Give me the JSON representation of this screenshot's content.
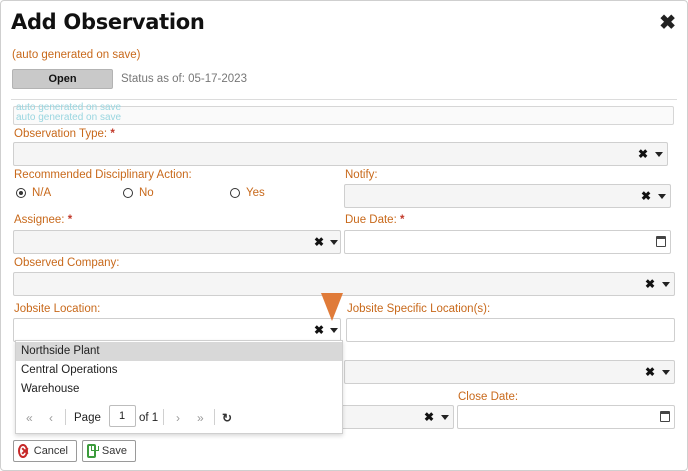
{
  "dialog": {
    "title": "Add Observation",
    "close_glyph": "✖",
    "auto_generated_note": "(auto generated on save)",
    "status_button_label": "Open",
    "status_prefix": "Status as of:",
    "status_date": "05-17-2023",
    "ghost_line_1": "auto generated on save",
    "ghost_line_2": "auto generated on save"
  },
  "form": {
    "observation_type": {
      "label": "Observation Type:",
      "required_mark": "*"
    },
    "recommended_action": {
      "label": "Recommended Disciplinary Action:",
      "options": [
        "N/A",
        "No",
        "Yes"
      ],
      "selected": "N/A"
    },
    "notify": {
      "label": "Notify:"
    },
    "assignee": {
      "label": "Assignee:",
      "required_mark": "*"
    },
    "due_date": {
      "label": "Due Date:",
      "required_mark": "*"
    },
    "observed_company": {
      "label": "Observed Company:"
    },
    "jobsite_location": {
      "label": "Jobsite Location:"
    },
    "jobsite_specific_location": {
      "label": "Jobsite Specific Location(s):"
    },
    "close_date": {
      "label": "Close Date:"
    }
  },
  "jobsite_dropdown": {
    "items": [
      "Northside Plant",
      "Central Operations",
      "Warehouse"
    ],
    "highlighted": "Northside Plant",
    "pager": {
      "page_label": "Page",
      "page_value": "1",
      "of_label": "of 1",
      "first_glyph": "«",
      "prev_glyph": "‹",
      "next_glyph": "›",
      "last_glyph": "»",
      "refresh_glyph": "↻"
    }
  },
  "controls": {
    "clear_glyph": "✖",
    "icons": {
      "clear": "clear-icon",
      "dropdown": "chevron-down-icon",
      "calendar": "calendar-icon"
    }
  },
  "footer": {
    "cancel_label": "Cancel",
    "save_label": "Save"
  },
  "colors": {
    "label": "#c8691b",
    "required": "#c23a2b",
    "annotation_arrow": "#e07b39",
    "cancel_icon": "#c62828",
    "save_icon": "#3b9b3b"
  }
}
